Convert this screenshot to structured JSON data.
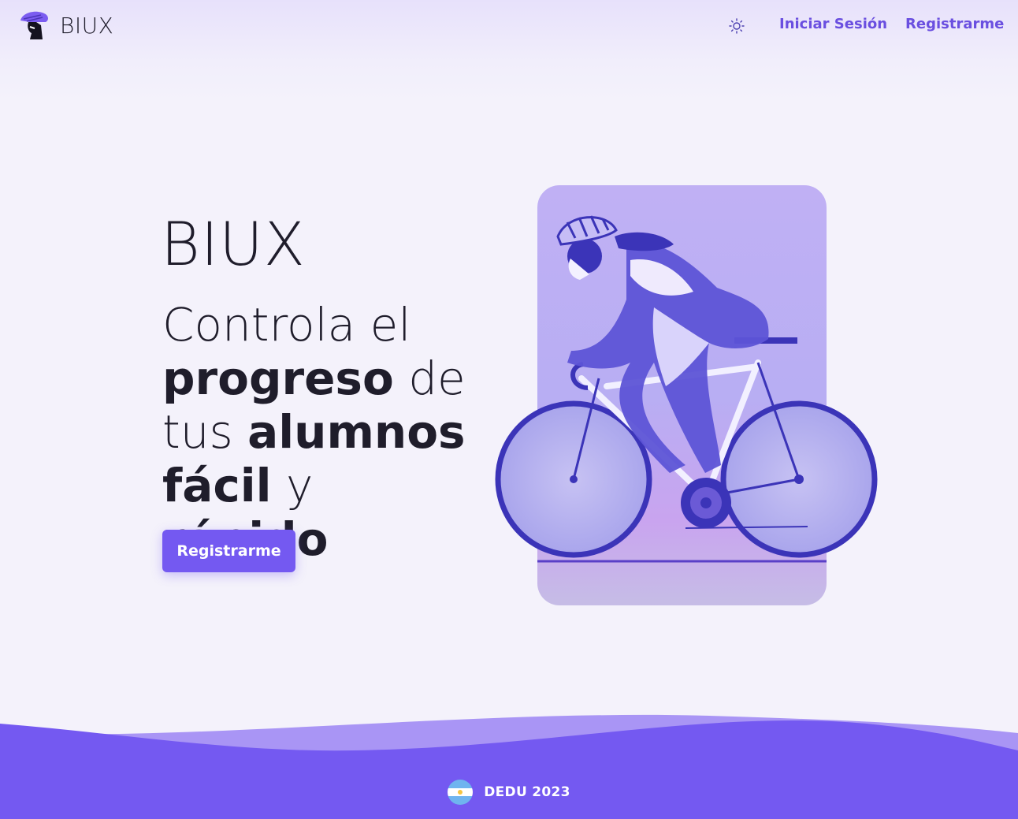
{
  "header": {
    "brand": "BIUX",
    "logo_icon": "cyclist-helmet-icon",
    "theme_icon": "sun-icon",
    "nav": {
      "login": "Iniciar Sesión",
      "register": "Registrarme"
    }
  },
  "hero": {
    "brand": "BIUX",
    "headline": {
      "line1": "Controla el",
      "line2_bold": "progreso",
      "line2_rest": " de",
      "line3_light": "tus ",
      "line3_bold": "alumnos",
      "line4_bold": "fácil",
      "line4_light": " y ",
      "line4_bold2": "rápido"
    },
    "cta": "Registrarme",
    "illustration_icon": "cyclist-illustration"
  },
  "footer": {
    "flag_icon": "argentina-flag-icon",
    "text": "DEDU 2023"
  },
  "colors": {
    "accent": "#7459f1",
    "nav_link": "#6a4fe0",
    "background": "#f4f2fb",
    "text": "#1f1d2b"
  }
}
